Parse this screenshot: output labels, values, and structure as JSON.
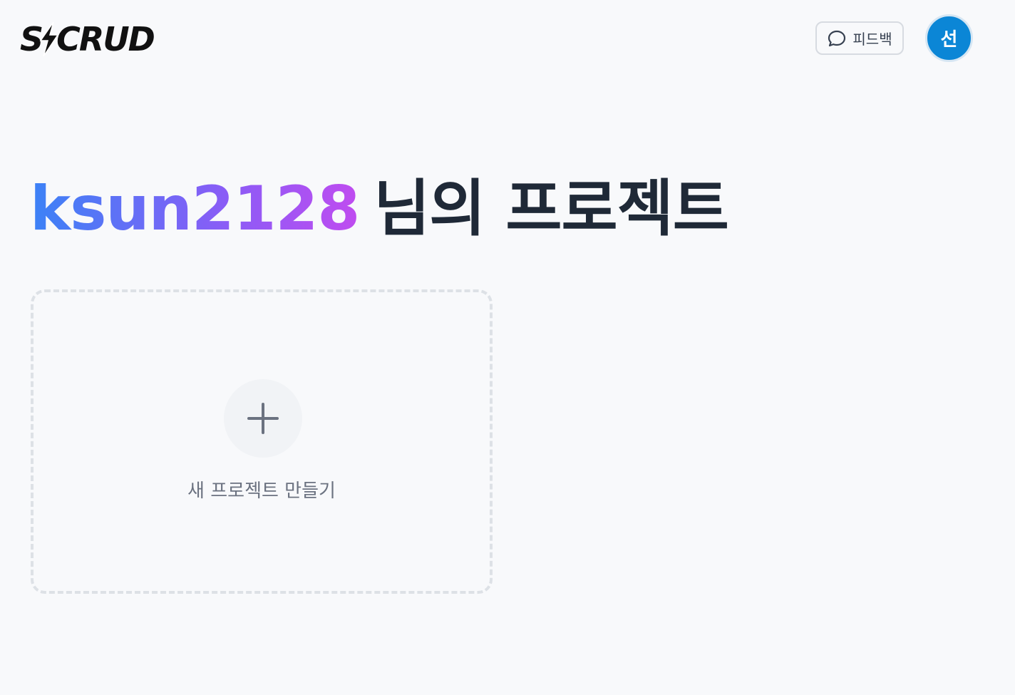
{
  "header": {
    "logo_text": "SCRUD",
    "feedback_label": "피드백",
    "avatar_initial": "선"
  },
  "main": {
    "username": "ksun2128",
    "title_suffix": "님의 프로젝트",
    "new_project_label": "새 프로젝트 만들기"
  },
  "colors": {
    "avatar_bg": "#0b86d6",
    "gradient_start": "#3b82f6",
    "gradient_end": "#c04cf0",
    "title_text": "#1f2937"
  },
  "icons": {
    "feedback": "chat-bubble-icon",
    "new_project": "plus-icon"
  }
}
